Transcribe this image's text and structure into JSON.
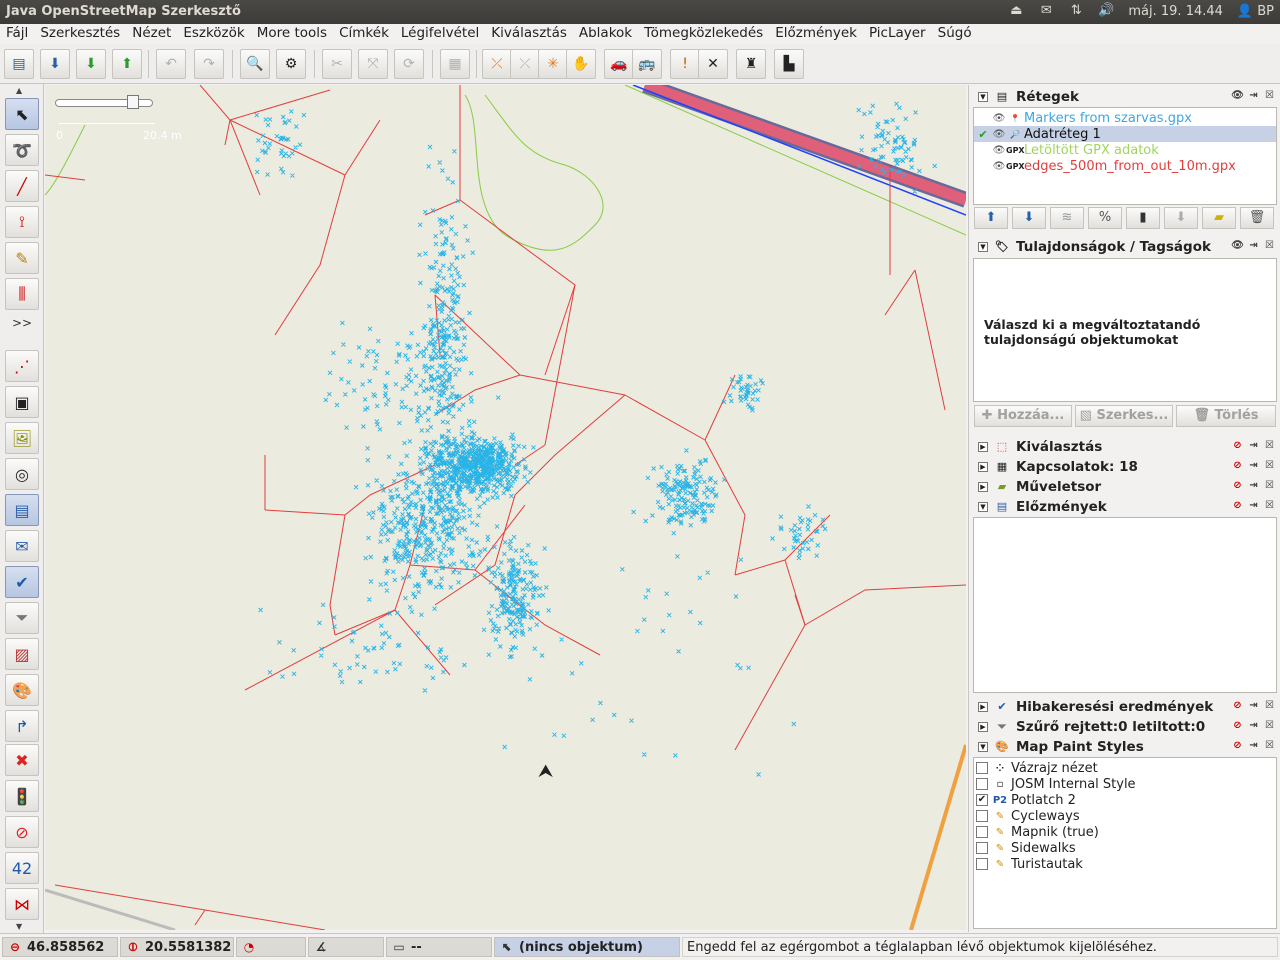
{
  "window": {
    "title": "Java OpenStreetMap Szerkesztő"
  },
  "tray": {
    "datetime": "máj. 19. 14.44",
    "user": "BP"
  },
  "menu": [
    "Fájl",
    "Szerkesztés",
    "Nézet",
    "Eszközök",
    "More tools",
    "Címkék",
    "Légifelvétel",
    "Kiválasztás",
    "Ablakok",
    "Tömegközlekedés",
    "Előzmények",
    "PicLayer",
    "Súgó"
  ],
  "scale": {
    "min_label": "0",
    "max_label": "20.4 m"
  },
  "layers_panel": {
    "title": "Rétegek",
    "items": [
      {
        "name": "Markers from szarvas.gpx",
        "color": "#3ea6e0",
        "icon": "marker-icon"
      },
      {
        "name": "Adatréteg 1",
        "color": "#111111",
        "icon": "data-layer-icon",
        "active": true
      },
      {
        "name": "Letöltött GPX adatok",
        "color": "#9fd65a",
        "icon": "GPX"
      },
      {
        "name": "edges_500m_from_out_10m.gpx",
        "color": "#e23d3d",
        "icon": "GPX"
      }
    ]
  },
  "properties_panel": {
    "title": "Tulajdonságok / Tagságok",
    "empty_message": "Válaszd ki a megváltoztatandó tulajdonságú objektumokat",
    "buttons": [
      "Hozzáa...",
      "Szerkes...",
      "Törlés"
    ]
  },
  "collapsed_panels": [
    "Kiválasztás",
    "Kapcsolatok: 18",
    "Műveletsor"
  ],
  "history_panel": {
    "title": "Előzmények"
  },
  "bottom_panels": [
    "Hibakeresési eredmények",
    "Szűrő rejtett:0 letiltott:0"
  ],
  "map_paint_styles": {
    "title": "Map Paint Styles",
    "items": [
      {
        "name": "Vázrajz nézet",
        "checked": false
      },
      {
        "name": "JOSM Internal Style",
        "checked": false
      },
      {
        "name": "Potlatch 2",
        "checked": true
      },
      {
        "name": "Cycleways",
        "checked": false
      },
      {
        "name": "Mapnik (true)",
        "checked": false
      },
      {
        "name": "Sidewalks",
        "checked": false
      },
      {
        "name": "Turistautak",
        "checked": false
      }
    ]
  },
  "status": {
    "lat": "46.858562",
    "lon": "20.5581382",
    "distance": "--",
    "selection": "(nincs objektum)",
    "hint": "Engedd fel az egérgombot a téglalapban lévő objektumok kijelöléséhez."
  },
  "more_tools_label": ">>"
}
